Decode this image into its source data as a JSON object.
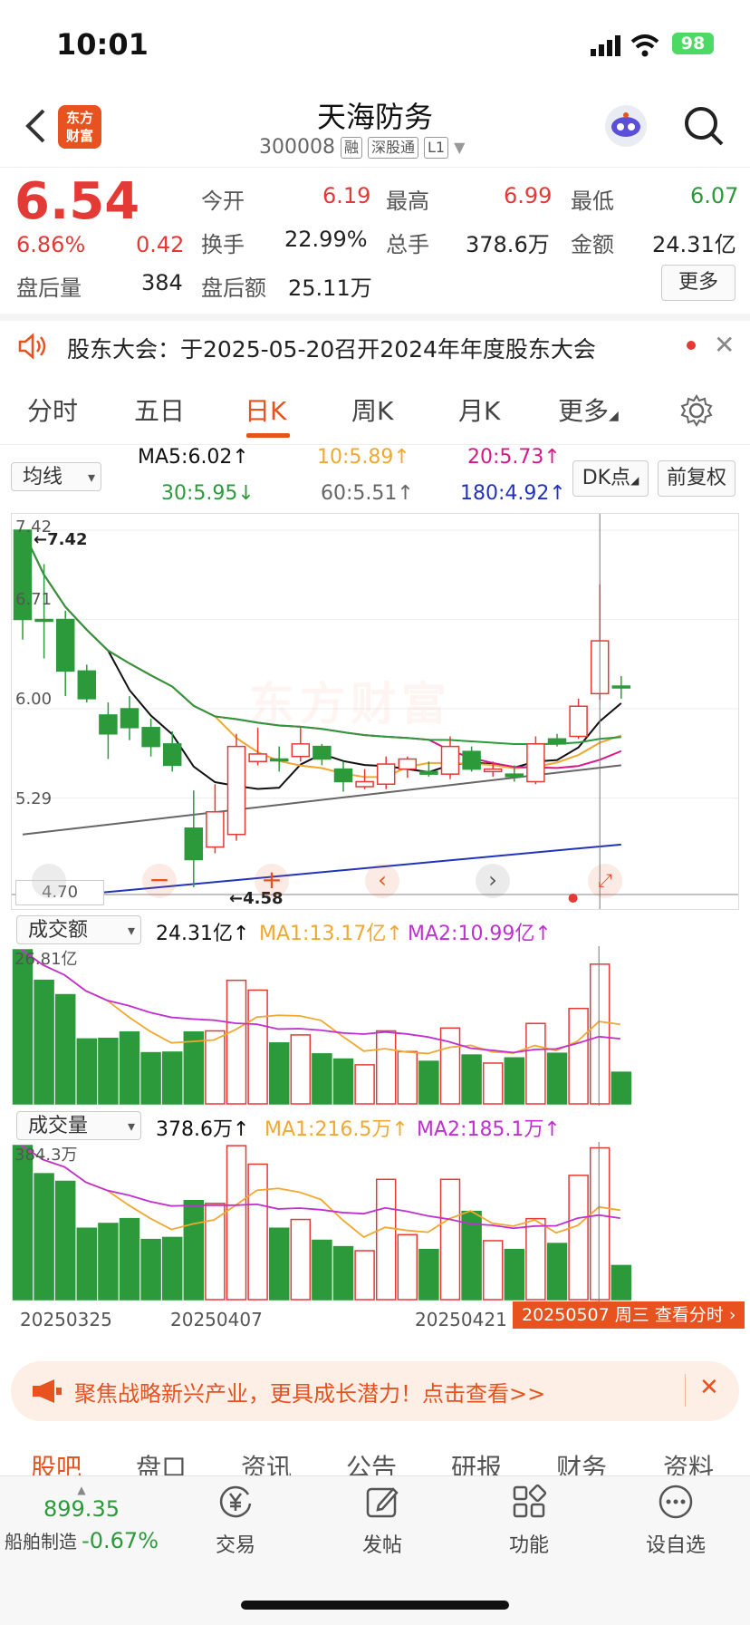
{
  "status_bar": {
    "time": "10:01",
    "battery": "98"
  },
  "header": {
    "back_icon": "chevron-left-icon",
    "logo_text_1": "东方",
    "logo_text_2": "财富",
    "stock_name": "天海防务",
    "stock_code": "300008",
    "tags": [
      "融",
      "深股通",
      "L1"
    ]
  },
  "quote": {
    "price": "6.54",
    "change_pct": "6.86%",
    "change_amt": "0.42",
    "open_label": "今开",
    "open": "6.19",
    "high_label": "最高",
    "high": "6.99",
    "low_label": "最低",
    "low": "6.07",
    "turnover_label": "换手",
    "turnover": "22.99%",
    "volume_label": "总手",
    "volume": "378.6万",
    "amount_label": "金额",
    "amount": "24.31亿",
    "after_vol_label": "盘后量",
    "after_vol": "384",
    "after_amt_label": "盘后额",
    "after_amt": "25.11万",
    "more_label": "更多"
  },
  "notice": {
    "text": "股东大会：于2025-05-20召开2024年年度股东大会"
  },
  "tabs": [
    "分时",
    "五日",
    "日K",
    "周K",
    "月K",
    "更多"
  ],
  "active_tab": "日K",
  "ma": {
    "selector": "均线",
    "ma5": "MA5:6.02↑",
    "ma10": "10:5.89↑",
    "ma20": "20:5.73↑",
    "ma30": "30:5.95↓",
    "ma60": "60:5.51↑",
    "ma180": "180:4.92↑",
    "dk_button": "DK点",
    "fq_button": "前复权",
    "colors": {
      "ma5": "#111111",
      "ma10": "#f0a830",
      "ma20": "#d6188a",
      "ma30": "#2c9a3b",
      "ma60": "#666666",
      "ma180": "#2233bb"
    }
  },
  "kline": {
    "y_labels": [
      "7.42",
      "6.71",
      "6.00",
      "5.29",
      "4.70"
    ],
    "max_marker": "←7.42",
    "min_marker": "←4.58",
    "watermark": "东方财富"
  },
  "amount_panel": {
    "selector": "成交额",
    "value": "24.31亿↑",
    "ma1": "MA1:13.17亿↑",
    "ma2": "MA2:10.99亿↑",
    "max_label": "26.81亿"
  },
  "volume_panel": {
    "selector": "成交量",
    "value": "378.6万↑",
    "ma1": "MA1:216.5万↑",
    "ma2": "MA2:185.1万↑",
    "max_label": "384.3万"
  },
  "x_dates": [
    "20250325",
    "20250407",
    "20250421"
  ],
  "date_badge": "20250507 周三  查看分时",
  "chart_data": {
    "type": "candlestick",
    "candles": [
      {
        "o": 6.71,
        "c": 7.42,
        "h": 7.42,
        "l": 6.55,
        "up": false
      },
      {
        "o": 6.71,
        "c": 6.71,
        "h": 7.15,
        "l": 6.4,
        "up": false
      },
      {
        "o": 6.71,
        "c": 6.3,
        "h": 6.78,
        "l": 6.1,
        "up": false
      },
      {
        "o": 6.3,
        "c": 6.08,
        "h": 6.35,
        "l": 6.05,
        "up": false
      },
      {
        "o": 5.95,
        "c": 5.8,
        "h": 6.05,
        "l": 5.6,
        "up": false
      },
      {
        "o": 6.0,
        "c": 5.85,
        "h": 6.1,
        "l": 5.75,
        "up": false
      },
      {
        "o": 5.85,
        "c": 5.7,
        "h": 5.92,
        "l": 5.62,
        "up": false
      },
      {
        "o": 5.72,
        "c": 5.55,
        "h": 5.82,
        "l": 5.5,
        "up": false
      },
      {
        "o": 5.05,
        "c": 4.8,
        "h": 5.35,
        "l": 4.58,
        "up": false
      },
      {
        "o": 4.9,
        "c": 5.18,
        "h": 5.4,
        "l": 4.85,
        "up": true
      },
      {
        "o": 5.0,
        "c": 5.7,
        "h": 5.8,
        "l": 4.95,
        "up": true
      },
      {
        "o": 5.64,
        "c": 5.58,
        "h": 5.85,
        "l": 5.55,
        "up": true
      },
      {
        "o": 5.6,
        "c": 5.6,
        "h": 5.7,
        "l": 5.5,
        "up": false
      },
      {
        "o": 5.62,
        "c": 5.72,
        "h": 5.85,
        "l": 5.58,
        "up": true
      },
      {
        "o": 5.7,
        "c": 5.6,
        "h": 5.72,
        "l": 5.55,
        "up": false
      },
      {
        "o": 5.52,
        "c": 5.42,
        "h": 5.58,
        "l": 5.34,
        "up": false
      },
      {
        "o": 5.38,
        "c": 5.42,
        "h": 5.52,
        "l": 5.36,
        "up": true
      },
      {
        "o": 5.4,
        "c": 5.56,
        "h": 5.62,
        "l": 5.36,
        "up": true
      },
      {
        "o": 5.52,
        "c": 5.6,
        "h": 5.62,
        "l": 5.45,
        "up": true
      },
      {
        "o": 5.5,
        "c": 5.48,
        "h": 5.58,
        "l": 5.46,
        "up": false
      },
      {
        "o": 5.48,
        "c": 5.7,
        "h": 5.78,
        "l": 5.44,
        "up": true
      },
      {
        "o": 5.66,
        "c": 5.52,
        "h": 5.7,
        "l": 5.5,
        "up": false
      },
      {
        "o": 5.52,
        "c": 5.5,
        "h": 5.58,
        "l": 5.46,
        "up": true
      },
      {
        "o": 5.48,
        "c": 5.46,
        "h": 5.55,
        "l": 5.42,
        "up": false
      },
      {
        "o": 5.42,
        "c": 5.72,
        "h": 5.78,
        "l": 5.4,
        "up": true
      },
      {
        "o": 5.72,
        "c": 5.76,
        "h": 5.8,
        "l": 5.7,
        "up": false
      },
      {
        "o": 5.78,
        "c": 6.02,
        "h": 6.08,
        "l": 5.76,
        "up": true
      },
      {
        "o": 6.12,
        "c": 6.54,
        "h": 6.99,
        "l": 6.07,
        "up": true
      },
      {
        "o": 6.18,
        "c": 6.18,
        "h": 6.26,
        "l": 6.08,
        "up": false
      }
    ],
    "amount": [
      26.81,
      21.5,
      19.0,
      11.3,
      11.4,
      12.5,
      8.9,
      9.0,
      12.5,
      12.7,
      21.5,
      19.8,
      10.6,
      12.0,
      8.7,
      7.8,
      6.8,
      12.7,
      9.1,
      7.4,
      13.2,
      8.5,
      7.1,
      8.0,
      14.0,
      8.8,
      16.6,
      24.31,
      5.5
    ],
    "volume": [
      384.3,
      314,
      295,
      178,
      190,
      202,
      150,
      155,
      247,
      240,
      384,
      338,
      178,
      200,
      148,
      132,
      122,
      300,
      162,
      125,
      300,
      220,
      147,
      125,
      202,
      140,
      310,
      378.6,
      85
    ]
  },
  "banner": {
    "text": "聚焦战略新兴产业，更具成长潜力！点击查看>>"
  },
  "sub_tabs": [
    "股吧",
    "盘口",
    "资讯",
    "公告",
    "研报",
    "财务",
    "资料"
  ],
  "bottom_bar": {
    "index_value": "899.35",
    "index_name": "船舶制造",
    "index_change": "-0.67%",
    "items": [
      "交易",
      "发帖",
      "功能",
      "设自选"
    ]
  }
}
